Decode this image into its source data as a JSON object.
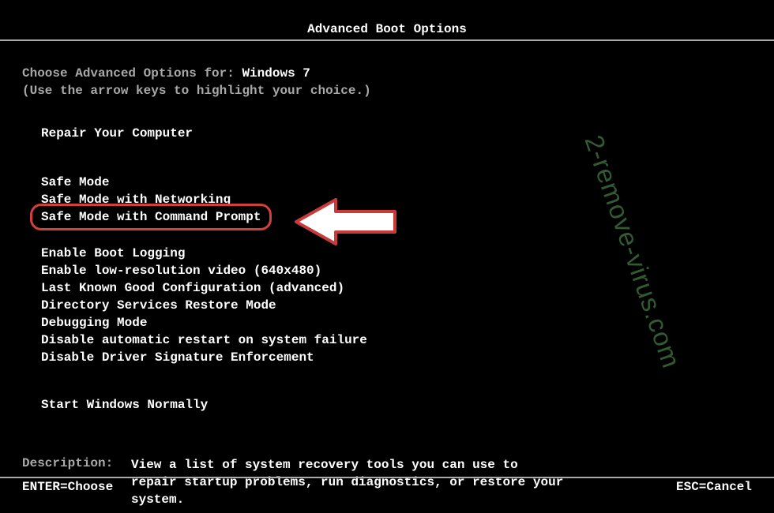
{
  "title": "Advanced Boot Options",
  "intro": {
    "prefix": "Choose Advanced Options for: ",
    "os": "Windows 7",
    "hint": "(Use the arrow keys to highlight your choice.)"
  },
  "groups": {
    "repair": "Repair Your Computer",
    "safe": [
      "Safe Mode",
      "Safe Mode with Networking",
      "Safe Mode with Command Prompt"
    ],
    "more": [
      "Enable Boot Logging",
      "Enable low-resolution video (640x480)",
      "Last Known Good Configuration (advanced)",
      "Directory Services Restore Mode",
      "Debugging Mode",
      "Disable automatic restart on system failure",
      "Disable Driver Signature Enforcement"
    ],
    "start": "Start Windows Normally"
  },
  "highlighted_index": 2,
  "description": {
    "label": "Description:",
    "text": "View a list of system recovery tools you can use to repair startup problems, run diagnostics, or restore your system."
  },
  "footer": {
    "enter": "ENTER=Choose",
    "esc": "ESC=Cancel"
  },
  "watermark": "2-remove-virus.com",
  "colors": {
    "highlight_ring": "#d13f3f",
    "watermark": "#3b6b3b"
  }
}
